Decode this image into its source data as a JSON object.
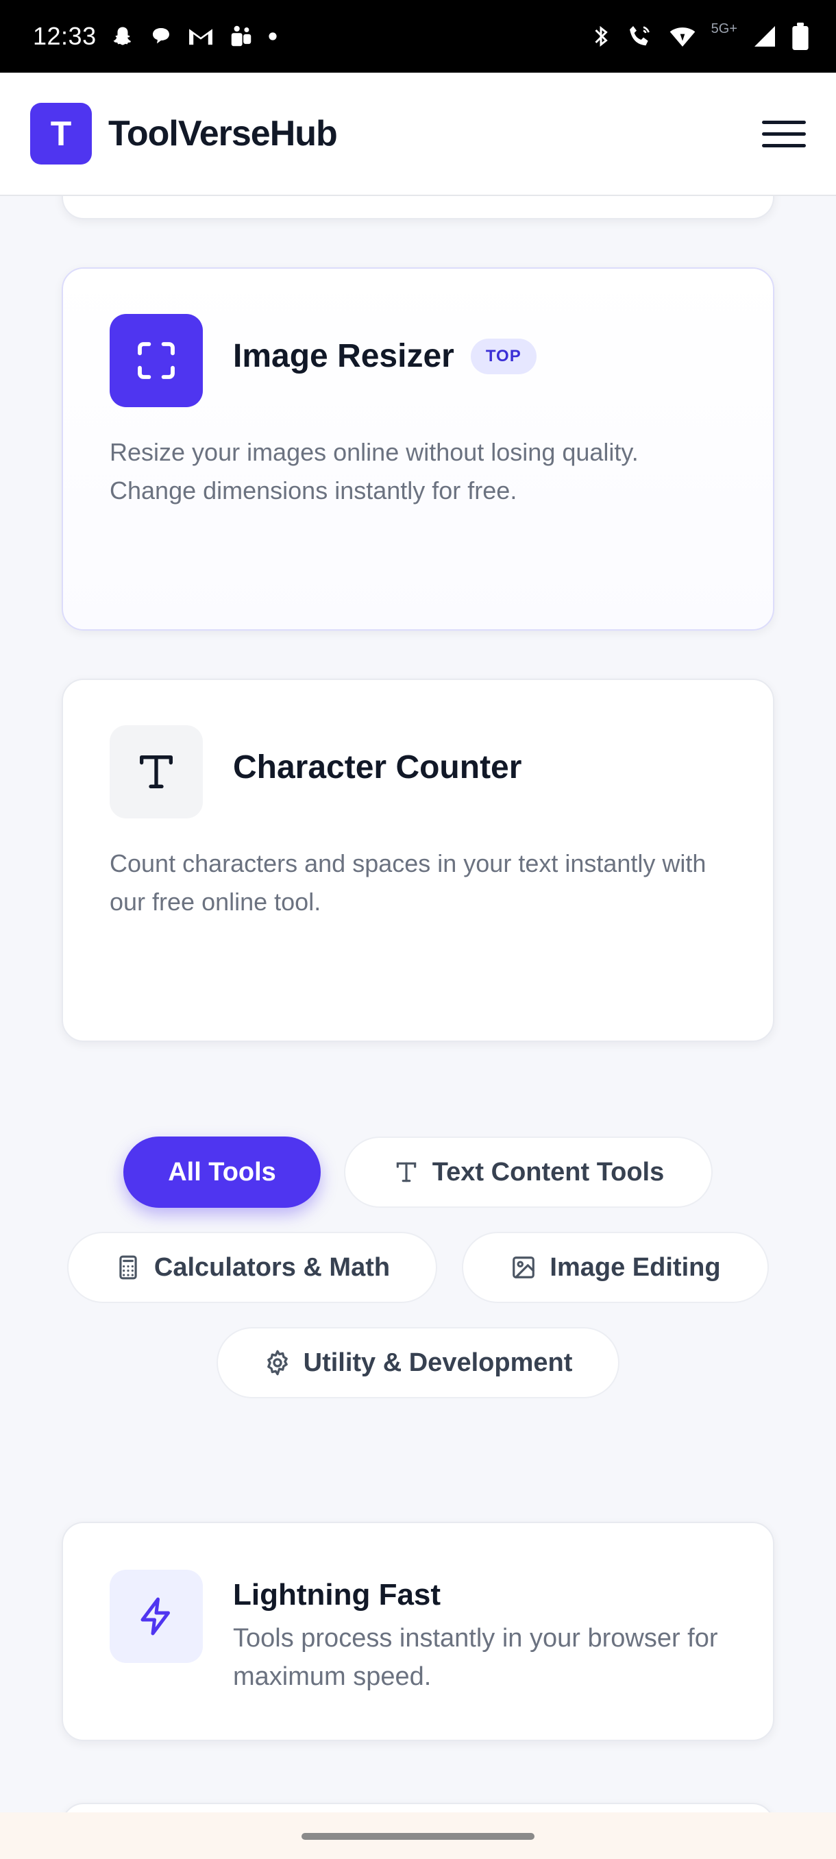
{
  "status_bar": {
    "time": "12:33",
    "left_icons": [
      "snapchat-icon",
      "chat-bubble-icon",
      "gmail-icon",
      "teams-icon",
      "dot-icon"
    ],
    "network_label": "5G+",
    "right_icons": [
      "bluetooth-icon",
      "wifi-call-icon",
      "wifi-icon",
      "signal-icon",
      "battery-icon"
    ]
  },
  "header": {
    "logo_letter": "T",
    "brand": "ToolVerseHub",
    "menu_icon": "hamburger-menu-icon"
  },
  "tools": [
    {
      "title": "Image Resizer",
      "badge": "TOP",
      "icon": "fullscreen-frame-icon",
      "description": "Resize your images online without losing quality. Change dimensions instantly for free."
    },
    {
      "title": "Character Counter",
      "icon": "text-type-icon",
      "description": "Count characters and spaces in your text instantly with our free online tool."
    }
  ],
  "filters": [
    {
      "label": "All Tools",
      "active": true
    },
    {
      "label": "Text Content Tools",
      "icon": "text-type-icon"
    },
    {
      "label": "Calculators & Math",
      "icon": "calculator-icon"
    },
    {
      "label": "Image Editing",
      "icon": "image-icon"
    },
    {
      "label": "Utility & Development",
      "icon": "gear-icon"
    }
  ],
  "feature": {
    "title": "Lightning Fast",
    "icon": "lightning-icon",
    "description": "Tools process instantly in your browser for maximum speed."
  },
  "colors": {
    "accent": "#4f35f0",
    "badge_bg": "#e6e7ff",
    "page_bg": "#f6f7fb"
  }
}
